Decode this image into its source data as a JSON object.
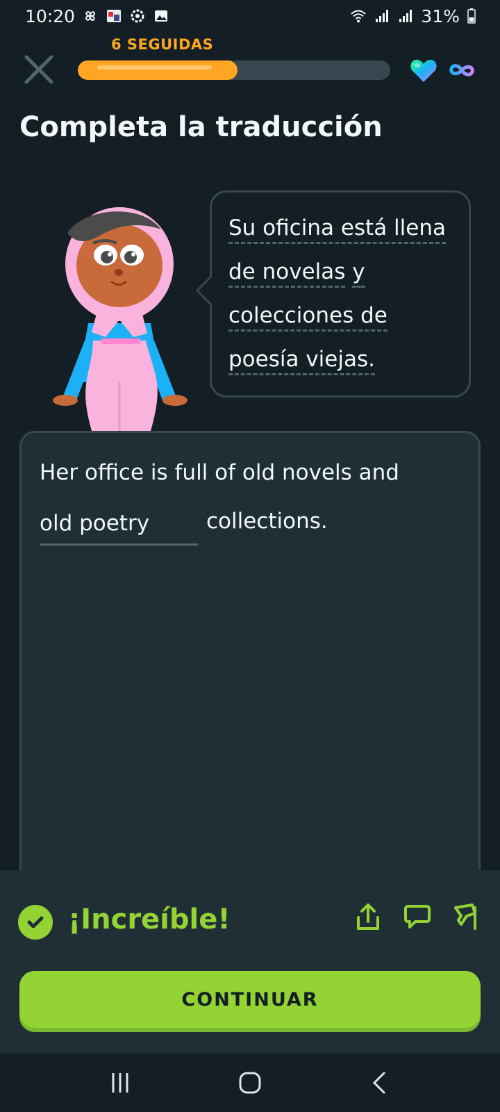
{
  "status_bar": {
    "time": "10:20",
    "battery": "31%",
    "icons": [
      "pinwheel-icon",
      "notification-app-icon",
      "settings-gear-icon",
      "image-icon",
      "wifi-icon",
      "signal-icon",
      "battery-icon"
    ]
  },
  "lesson_header": {
    "streak_label": "6 SEGUIDAS",
    "progress_fraction": 0.51,
    "icons": [
      "close-icon",
      "heart-icon",
      "infinity-icon"
    ]
  },
  "title": "Completa la traducción",
  "speech_bubble": {
    "line1": "Su oficina está llena",
    "line2_a": "de novelas",
    "line2_b": "y",
    "line3": "colecciones de",
    "line4": "poesía viejas."
  },
  "answer": {
    "line1": "Her office is full of old novels and",
    "blank_value": "old poetry",
    "after_blank": "collections."
  },
  "feedback": {
    "message": "¡Increíble!",
    "icons": [
      "share-icon",
      "comment-icon",
      "report-flag-icon"
    ],
    "continue_label": "CONTINUAR"
  },
  "colors": {
    "background": "#131f24",
    "card": "#202f36",
    "border": "#37464f",
    "accent_green": "#93d333",
    "streak_orange": "#ffa524"
  }
}
